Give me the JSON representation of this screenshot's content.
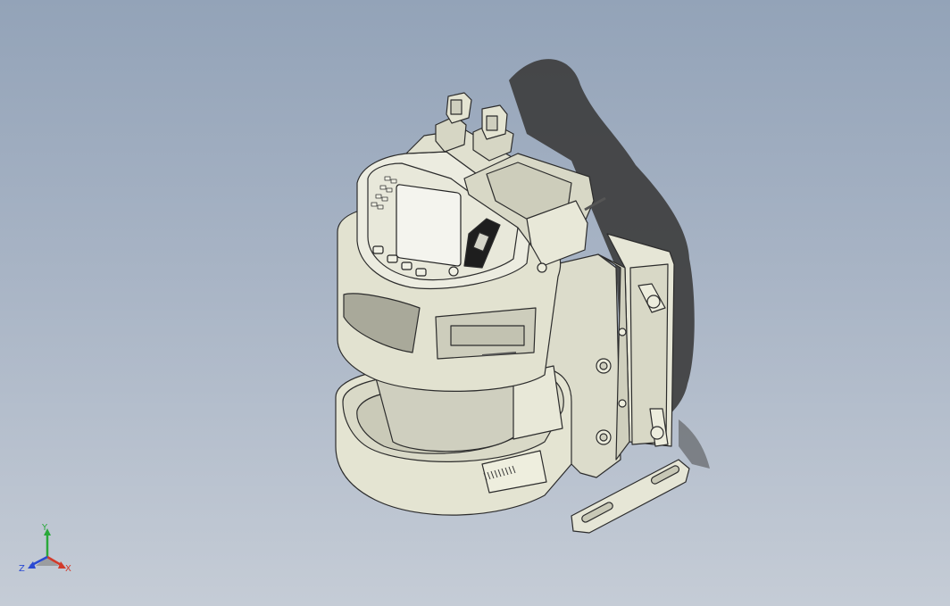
{
  "view": {
    "background_top": "#93a3b8",
    "background_bottom": "#c5ccd6",
    "model_color": "#e4e4d2",
    "outline_color": "#2c2c2c",
    "shadow_color": "#3c3c3c"
  },
  "triad": {
    "x_label": "X",
    "y_label": "Y",
    "z_label": "Z",
    "x_color": "#d23a2a",
    "y_color": "#2aa83a",
    "z_color": "#2a4ad2"
  }
}
